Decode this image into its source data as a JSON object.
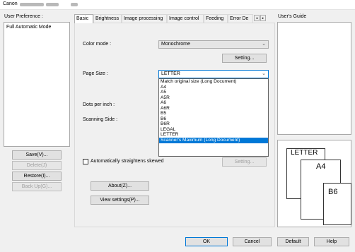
{
  "window": {
    "title": "Canon"
  },
  "left": {
    "label": "User Preference :",
    "items": [
      "Full Automatic Mode"
    ],
    "buttons": {
      "save": "Save(V)...",
      "delete": "Delete(J)",
      "restore": "Restore(I)...",
      "backup": "Back Up(G)..."
    }
  },
  "tabs": [
    "Basic",
    "Brightness",
    "Image processing",
    "Image control",
    "Feeding",
    "Error De"
  ],
  "tab_scroll": {
    "left": "◂",
    "right": "▸"
  },
  "form": {
    "color_mode_label": "Color mode :",
    "color_mode_value": "Monochrome",
    "setting_button": "Setting...",
    "page_size_label": "Page Size :",
    "page_size_value": "LETTER",
    "dpi_label": "Dots per inch :",
    "scanning_side_label": "Scanning Side :",
    "straighten_label": "Automatically straightens skewed",
    "setting_button2": "Setting...",
    "about_button": "About(Z)...",
    "view_settings_button": "View settings(P)..."
  },
  "dropdown": {
    "options": [
      "Match original size (Long Document)",
      "A4",
      "A5",
      "A5R",
      "A6",
      "A6R",
      "B5",
      "B6",
      "B6R",
      "LEGAL",
      "LETTER",
      "Scanner's Maximum (Long Document)"
    ],
    "selected_index": 11
  },
  "guide": {
    "label": "User's Guide"
  },
  "preview": {
    "papers": [
      "LETTER",
      "A4",
      "B6"
    ]
  },
  "bottom": {
    "ok": "OK",
    "cancel": "Cancel",
    "default": "Default",
    "help": "Help"
  },
  "icons": {
    "combo_arrow": "chevron-down-icon"
  },
  "colors": {
    "accent": "#0078d7",
    "selection": "#0078d7"
  }
}
